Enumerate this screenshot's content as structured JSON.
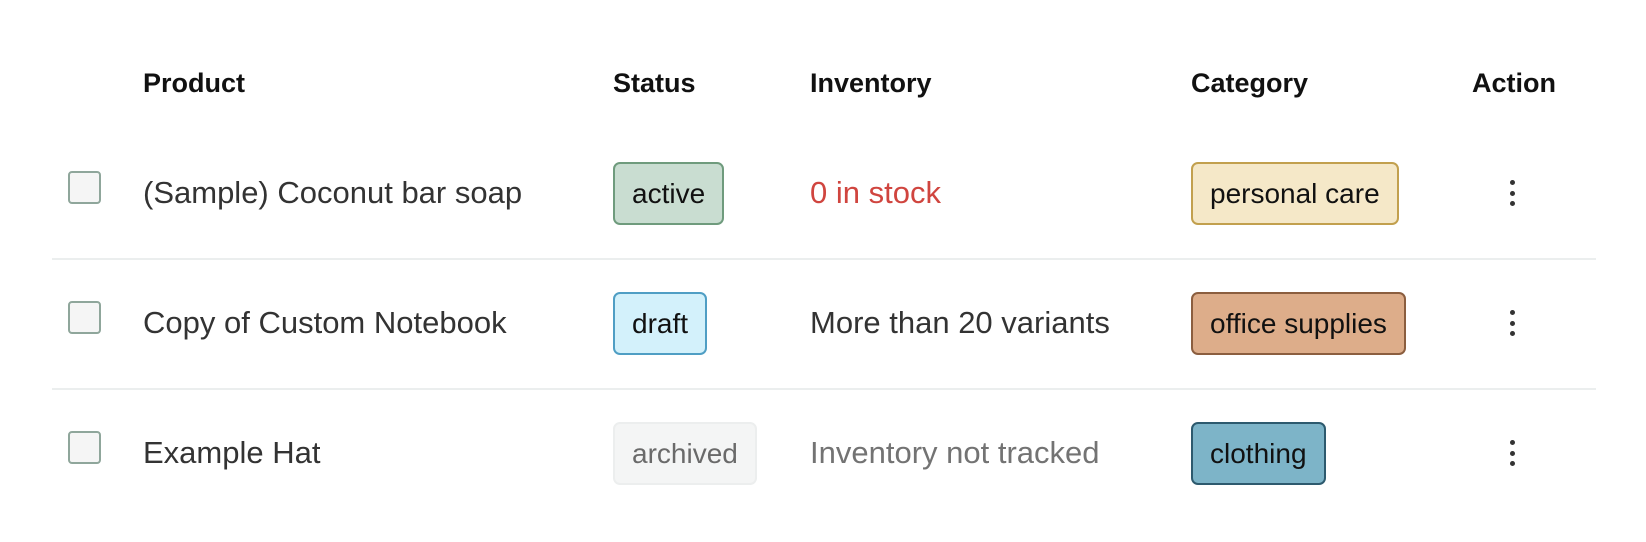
{
  "columns": {
    "product": "Product",
    "status": "Status",
    "inventory": "Inventory",
    "category": "Category",
    "action": "Action"
  },
  "rows": [
    {
      "product": "(Sample) Coconut bar soap",
      "status": {
        "label": "active",
        "bg": "#c9ddd1",
        "border": "#6f9b7d",
        "color": "#111111"
      },
      "inventory": {
        "text": "0 in stock",
        "color": "#d0453f"
      },
      "category": {
        "label": "personal care",
        "bg": "#f5e8c8",
        "border": "#c2a04e",
        "color": "#111111"
      },
      "action_icon": "more-vertical-icon"
    },
    {
      "product": "Copy of Custom Notebook",
      "status": {
        "label": "draft",
        "bg": "#d3f1fb",
        "border": "#4f9ec4",
        "color": "#111111"
      },
      "inventory": {
        "text": "More than 20 variants",
        "color": "#333333"
      },
      "category": {
        "label": "office supplies",
        "bg": "#ddad8a",
        "border": "#8b5e3f",
        "color": "#111111"
      },
      "action_icon": "more-vertical-icon"
    },
    {
      "product": "Example Hat",
      "status": {
        "label": "archived",
        "bg": "#f4f5f5",
        "border": "#eceeee",
        "color": "#6a6a6a"
      },
      "inventory": {
        "text": "Inventory not tracked",
        "color": "#737373"
      },
      "category": {
        "label": "clothing",
        "bg": "#7db4c8",
        "border": "#2d5a6e",
        "color": "#111111"
      },
      "action_icon": "more-vertical-icon"
    }
  ]
}
